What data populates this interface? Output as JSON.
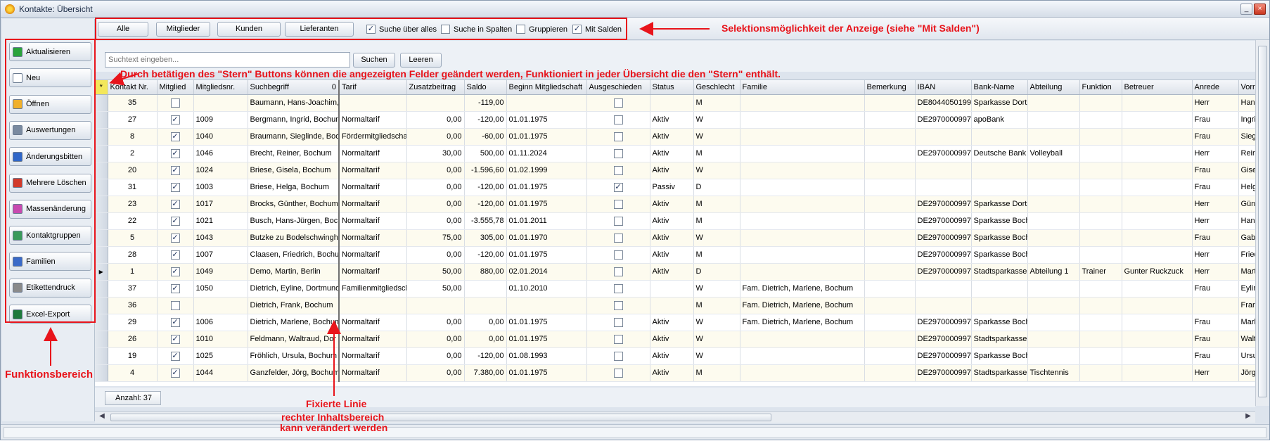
{
  "window": {
    "title": "Kontakte: Übersicht",
    "minimize": "_",
    "close": "×"
  },
  "functions": [
    {
      "label": "Aktualisieren",
      "icon": "refresh-icon",
      "color": "#2aa33b"
    },
    {
      "label": "Neu",
      "icon": "new-document-icon",
      "color": "#ffffff"
    },
    {
      "label": "Öffnen",
      "icon": "open-folder-icon",
      "color": "#f0b02c"
    },
    {
      "label": "Auswertungen",
      "icon": "report-icon",
      "color": "#7a8aa0"
    },
    {
      "label": "Änderungsbitten",
      "icon": "pencil-icon",
      "color": "#2f66c8"
    },
    {
      "label": "Mehrere Löschen",
      "icon": "delete-icon",
      "color": "#d23a2a"
    },
    {
      "label": "Massenänderung",
      "icon": "bulk-edit-icon",
      "color": "#c84ab0"
    },
    {
      "label": "Kontaktgruppen",
      "icon": "group-icon",
      "color": "#3a9a5a"
    },
    {
      "label": "Familien",
      "icon": "family-icon",
      "color": "#3a6ac8"
    },
    {
      "label": "Etikettendruck",
      "icon": "label-print-icon",
      "color": "#8a8a8a"
    },
    {
      "label": "Excel-Export",
      "icon": "excel-export-icon",
      "color": "#1f7a3c"
    }
  ],
  "toolbar": {
    "buttons": [
      "Alle",
      "Mitglieder",
      "Kunden",
      "Lieferanten"
    ],
    "checkboxes": [
      {
        "label": "Suche über alles",
        "checked": true
      },
      {
        "label": "Suche in Spalten",
        "checked": false
      },
      {
        "label": "Gruppieren",
        "checked": false
      },
      {
        "label": "Mit Salden",
        "checked": true
      }
    ]
  },
  "search": {
    "placeholder": "Suchtext eingeben...",
    "search_label": "Suchen",
    "clear_label": "Leeren"
  },
  "grid": {
    "star": "*",
    "sort_indicator": "0",
    "columns": [
      "Kontakt Nr.",
      "Mitglied",
      "Mitgliedsnr.",
      "Suchbegriff",
      "Tarif",
      "Zusatzbeitrag",
      "Saldo",
      "Beginn Mitgliedschaft",
      "Ausgeschieden",
      "Status",
      "Geschlecht",
      "Familie",
      "Bemerkung",
      "IBAN",
      "Bank-Name",
      "Abteilung",
      "Funktion",
      "Betreuer",
      "Anrede",
      "Vornam"
    ],
    "rows": [
      [
        "35",
        false,
        "",
        "Baumann, Hans-Joachim,",
        "",
        "",
        "-119,00",
        "",
        false,
        "",
        "M",
        "",
        "",
        "DE80440501999",
        "Sparkasse Dort",
        "",
        "",
        "",
        "Herr",
        "Hans-J"
      ],
      [
        "27",
        true,
        "1009",
        "Bergmann, Ingrid, Bochum",
        "Normaltarif",
        "0,00",
        "-120,00",
        "01.01.1975",
        false,
        "Aktiv",
        "W",
        "",
        "",
        "DE2970000997",
        "apoBank",
        "",
        "",
        "",
        "Frau",
        "Ingrid"
      ],
      [
        "8",
        true,
        "1040",
        "Braumann, Sieglinde, Boc",
        "Fördermitgliedscha",
        "0,00",
        "-60,00",
        "01.01.1975",
        false,
        "Aktiv",
        "W",
        "",
        "",
        "",
        "",
        "",
        "",
        "",
        "Frau",
        "Sieglin"
      ],
      [
        "2",
        true,
        "1046",
        "Brecht, Reiner, Bochum",
        "Normaltarif",
        "30,00",
        "500,00",
        "01.11.2024",
        false,
        "Aktiv",
        "M",
        "",
        "",
        "DE2970000997",
        "Deutsche Bank",
        "Volleyball",
        "",
        "",
        "Herr",
        "Reiner"
      ],
      [
        "20",
        true,
        "1024",
        "Briese, Gisela, Bochum",
        "Normaltarif",
        "0,00",
        "-1.596,60",
        "01.02.1999",
        false,
        "Aktiv",
        "W",
        "",
        "",
        "",
        "",
        "",
        "",
        "",
        "Frau",
        "Gisela"
      ],
      [
        "31",
        true,
        "1003",
        "Briese, Helga, Bochum",
        "Normaltarif",
        "0,00",
        "-120,00",
        "01.01.1975",
        true,
        "Passiv",
        "D",
        "",
        "",
        "",
        "",
        "",
        "",
        "",
        "Frau",
        "Helga"
      ],
      [
        "23",
        true,
        "1017",
        "Brocks, Günther, Bochum",
        "Normaltarif",
        "0,00",
        "-120,00",
        "01.01.1975",
        false,
        "Aktiv",
        "M",
        "",
        "",
        "DE2970000997",
        "Sparkasse Dort",
        "",
        "",
        "",
        "Herr",
        "Günthe"
      ],
      [
        "22",
        true,
        "1021",
        "Busch, Hans-Jürgen, Boch",
        "Normaltarif",
        "0,00",
        "-3.555,78",
        "01.01.2011",
        false,
        "Aktiv",
        "M",
        "",
        "",
        "DE2970000997",
        "Sparkasse Boch",
        "",
        "",
        "",
        "Herr",
        "Hans-J"
      ],
      [
        "5",
        true,
        "1043",
        "Butzke zu Bodelschwingh,",
        "Normaltarif",
        "75,00",
        "305,00",
        "01.01.1970",
        false,
        "Aktiv",
        "W",
        "",
        "",
        "DE2970000997",
        "Sparkasse Boch",
        "",
        "",
        "",
        "Frau",
        "Gaby"
      ],
      [
        "28",
        true,
        "1007",
        "Claasen, Friedrich, Bochu",
        "Normaltarif",
        "0,00",
        "-120,00",
        "01.01.1975",
        false,
        "Aktiv",
        "M",
        "",
        "",
        "DE2970000997",
        "Sparkasse Boch",
        "",
        "",
        "",
        "Herr",
        "Friedri"
      ],
      [
        "1",
        true,
        "1049",
        "Demo, Martin, Berlin",
        "Normaltarif",
        "50,00",
        "880,00",
        "02.01.2014",
        false,
        "Aktiv",
        "D",
        "",
        "",
        "DE2970000997",
        "Stadtsparkasse",
        "Abteilung 1",
        "Trainer",
        "Gunter Ruckzuck",
        "Herr",
        "Martin"
      ],
      [
        "37",
        true,
        "1050",
        "Dietrich, Eyline, Dortmund",
        "Familienmitgliedsch",
        "50,00",
        "",
        "01.10.2010",
        false,
        "",
        "W",
        "Fam. Dietrich, Marlene, Bochum",
        "",
        "",
        "",
        "",
        "",
        "",
        "Frau",
        "Eyline"
      ],
      [
        "36",
        false,
        "",
        "Dietrich, Frank, Bochum",
        "",
        "",
        "",
        "",
        false,
        "",
        "M",
        "Fam. Dietrich, Marlene, Bochum",
        "",
        "",
        "",
        "",
        "",
        "",
        "",
        "Frank"
      ],
      [
        "29",
        true,
        "1006",
        "Dietrich, Marlene, Bochum",
        "Normaltarif",
        "0,00",
        "0,00",
        "01.01.1975",
        false,
        "Aktiv",
        "W",
        "Fam. Dietrich, Marlene, Bochum",
        "",
        "DE2970000997",
        "Sparkasse Boch",
        "",
        "",
        "",
        "Frau",
        "Marlen"
      ],
      [
        "26",
        true,
        "1010",
        "Feldmann, Waltraud, Dor",
        "Normaltarif",
        "0,00",
        "0,00",
        "01.01.1975",
        false,
        "Aktiv",
        "W",
        "",
        "",
        "DE2970000997",
        "Stadtsparkasse",
        "",
        "",
        "",
        "Frau",
        "Waltrau"
      ],
      [
        "19",
        true,
        "1025",
        "Fröhlich, Ursula, Bochum",
        "Normaltarif",
        "0,00",
        "-120,00",
        "01.08.1993",
        false,
        "Aktiv",
        "W",
        "",
        "",
        "DE2970000997",
        "Sparkasse Boch",
        "",
        "",
        "",
        "Frau",
        "Ursula"
      ],
      [
        "4",
        true,
        "1044",
        "Ganzfelder, Jörg, Bochum",
        "Normaltarif",
        "0,00",
        "7.380,00",
        "01.01.1975",
        false,
        "Aktiv",
        "M",
        "",
        "",
        "DE2970000997",
        "Stadtsparkasse",
        "Tischtennis",
        "",
        "",
        "Herr",
        "Jörg"
      ]
    ],
    "current_row_index": 10
  },
  "footer": {
    "count": "Anzahl: 37"
  },
  "annotations": {
    "selection": "Selektionsmöglichkeit der Anzeige (siehe \"Mit Salden\")",
    "star": "Durch betätigen des \"Stern\" Buttons können die angezeigten Felder geändert werden, Funktioniert in jeder Übersicht die den \"Stern\" enthält.",
    "functions": "Funktionsbereich",
    "fixed_line_1": "Fixierte Linie",
    "fixed_line_2": "rechter Inhaltsbereich",
    "fixed_line_3": "kann verändert werden"
  }
}
